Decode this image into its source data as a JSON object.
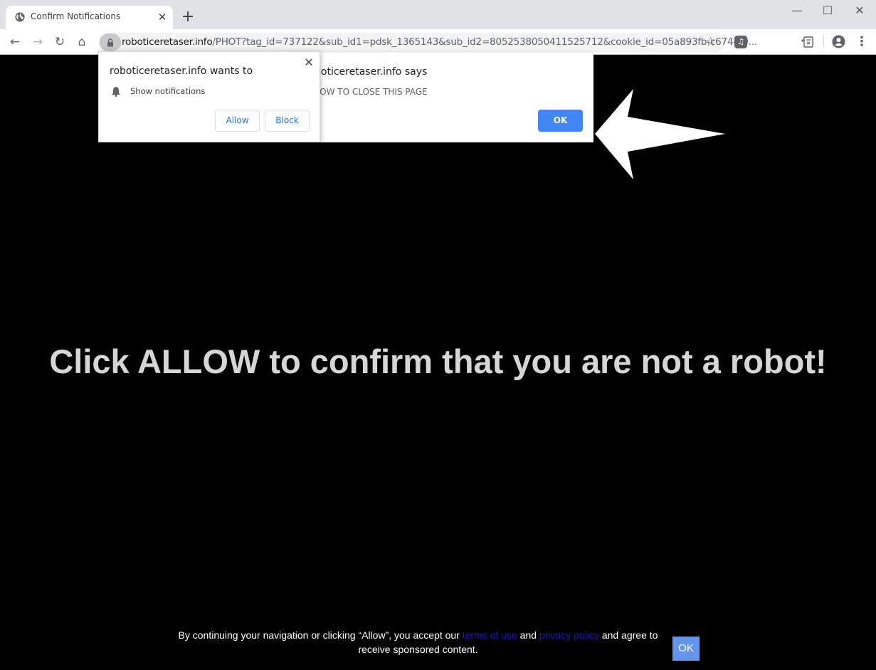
{
  "browser": {
    "tab": {
      "title": "Confirm Notifications",
      "favicon": "globe-icon",
      "close_label": "✕"
    },
    "new_tab_label": "+",
    "window_controls": {
      "minimize": "—",
      "maximize": "☐",
      "close": "✕"
    },
    "nav": {
      "back": "←",
      "forward": "→",
      "reload": "↻",
      "home": "⌂"
    },
    "address_bar": {
      "host": "roboticeretaser.info",
      "path": "/PHOT?tag_id=737122&sub_id1=pdsk_1365143&sub_id2=8052538050411525712&cookie_id=05a893fb-c674-40...",
      "lock_icon": "lock-icon",
      "bookmark_icon": "☆"
    },
    "extensions": {
      "music": "♫",
      "menu": "⋮"
    }
  },
  "permission_prompt": {
    "title": "roboticeretaser.info wants to",
    "permission": "Show notifications",
    "close_label": "✕",
    "allow_label": "Allow",
    "block_label": "Block"
  },
  "alert_dialog": {
    "title": "roboticeretaser.info says",
    "message": "ALLOW TO CLOSE THIS PAGE",
    "ok_label": "OK"
  },
  "page": {
    "headline": "Click ALLOW to confirm that you are not a robot!",
    "consent": {
      "text_before": "By continuing your navigation or clicking “Allow”, you accept our ",
      "terms_link": "terms of use",
      "text_and": " and ",
      "privacy_link": "privacy policy",
      "text_after": " and agree to receive sponsored content.",
      "ok_label": "OK"
    }
  },
  "colors": {
    "accent_blue": "#4285f4",
    "consent_ok": "#6495ed",
    "link_color": "#1a12c8",
    "headline": "#d6d6d6"
  }
}
